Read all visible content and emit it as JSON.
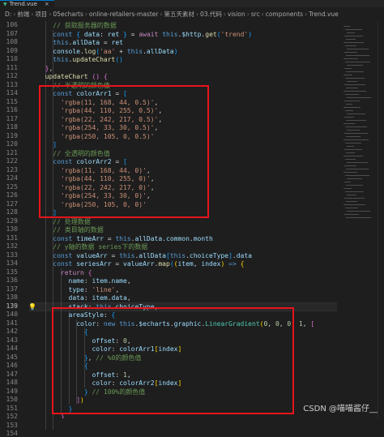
{
  "tab": {
    "label": "Trend.vue",
    "close": "×"
  },
  "breadcrumb": [
    "D:",
    "前端",
    "项目",
    "05echarts",
    "online-retailers-master",
    "第五天素材",
    "03.代码",
    "vision",
    "src",
    "components",
    "Trend.vue"
  ],
  "watermark": "CSDN @喵喵酱仔__",
  "lines": [
    {
      "n": "106",
      "h": "<span class=\"cm\">// 获取服务器的数据</span>",
      "i": 4
    },
    {
      "n": "107",
      "h": "<span class=\"kw\">const</span> <span class=\"br3\">{</span> <span class=\"var\">data</span>: <span class=\"var\">ret</span> <span class=\"br3\">}</span> = <span class=\"kw2\">await</span> <span class=\"kw\">this</span>.<span class=\"var\">$http</span>.<span class=\"fn\">get</span><span class=\"br3\">(</span><span class=\"str\">'trend'</span><span class=\"br3\">)</span>",
      "i": 4
    },
    {
      "n": "108",
      "h": "<span class=\"kw\">this</span>.<span class=\"var\">allData</span> = <span class=\"var\">ret</span>",
      "i": 4
    },
    {
      "n": "109",
      "h": "<span class=\"var\">console</span>.<span class=\"fn\">log</span><span class=\"br3\">(</span><span class=\"str\">'aa'</span> + <span class=\"kw\">this</span>.<span class=\"var\">allData</span><span class=\"br3\">)</span>",
      "i": 4
    },
    {
      "n": "110",
      "h": "<span class=\"kw\">this</span>.<span class=\"fn\">updateChart</span><span class=\"br3\">()</span>",
      "i": 4
    },
    {
      "n": "111",
      "h": "<span class=\"br2\">}</span>,",
      "i": 2
    },
    {
      "n": "112",
      "h": "<span class=\"fn\">updateChart</span> <span class=\"br2\">()</span> <span class=\"br2\">{</span>",
      "i": 2
    },
    {
      "n": "113",
      "h": "<span class=\"cm\">// 半透明的颜色值</span>",
      "i": 4
    },
    {
      "n": "114",
      "h": "<span class=\"kw\">const</span> <span class=\"var\">colorArr1</span> = <span class=\"br3\">[</span>",
      "i": 4
    },
    {
      "n": "115",
      "h": "<span class=\"str\">'rgba(11, 168, 44, 0.5)'</span>,",
      "i": 6
    },
    {
      "n": "116",
      "h": "<span class=\"str\">'rgba(44, 110, 255, 0.5)'</span>,",
      "i": 6
    },
    {
      "n": "117",
      "h": "<span class=\"str\">'rgba(22, 242, 217, 0.5)'</span>,",
      "i": 6
    },
    {
      "n": "118",
      "h": "<span class=\"str\">'rgba(254, 33, 30, 0.5)'</span>,",
      "i": 6
    },
    {
      "n": "119",
      "h": "<span class=\"str\">'rgba(250, 105, 0, 0.5)'</span>",
      "i": 6
    },
    {
      "n": "120",
      "h": "<span class=\"br3\">]</span>",
      "i": 4
    },
    {
      "n": "121",
      "h": "<span class=\"cm\">// 全透明的颜色值</span>",
      "i": 4
    },
    {
      "n": "122",
      "h": "<span class=\"kw\">const</span> <span class=\"var\">colorArr2</span> = <span class=\"br3\">[</span>",
      "i": 4
    },
    {
      "n": "123",
      "h": "<span class=\"str\">'rgba(11, 168, 44, 0)'</span>,",
      "i": 6
    },
    {
      "n": "124",
      "h": "<span class=\"str\">'rgba(44, 110, 255, 0)'</span>,",
      "i": 6
    },
    {
      "n": "125",
      "h": "<span class=\"str\">'rgba(22, 242, 217, 0)'</span>,",
      "i": 6
    },
    {
      "n": "126",
      "h": "<span class=\"str\">'rgba(254, 33, 30, 0)'</span>,",
      "i": 6
    },
    {
      "n": "127",
      "h": "<span class=\"str\">'rgba(250, 105, 0, 0)'</span>",
      "i": 6
    },
    {
      "n": "128",
      "h": "<span class=\"br3\">]</span>",
      "i": 4
    },
    {
      "n": "129",
      "h": "<span class=\"cm\">// 处理数据</span>",
      "i": 4
    },
    {
      "n": "130",
      "h": "<span class=\"cm\">// 类目轴的数据</span>",
      "i": 4
    },
    {
      "n": "131",
      "h": "<span class=\"kw\">const</span> <span class=\"var\">timeArr</span> = <span class=\"kw\">this</span>.<span class=\"var\">allData</span>.<span class=\"var\">common</span>.<span class=\"var\">month</span>",
      "i": 4
    },
    {
      "n": "132",
      "h": "<span class=\"cm\">// y轴的数据 series下的数据</span>",
      "i": 4
    },
    {
      "n": "133",
      "h": "<span class=\"kw\">const</span> <span class=\"var\">valueArr</span> = <span class=\"kw\">this</span>.<span class=\"var\">allData</span><span class=\"br3\">[</span><span class=\"kw\">this</span>.<span class=\"var\">choiceType</span><span class=\"br3\">]</span>.<span class=\"var\">data</span>",
      "i": 4
    },
    {
      "n": "134",
      "h": "<span class=\"kw\">const</span> <span class=\"var\">seriesArr</span> = <span class=\"var\">valueArr</span>.<span class=\"fn\">map</span><span class=\"br3\">(</span><span class=\"br\">(</span><span class=\"var\">item</span>, <span class=\"var\">index</span><span class=\"br\">)</span> <span class=\"kw\">=&gt;</span> <span class=\"br\">{</span>",
      "i": 4
    },
    {
      "n": "135",
      "h": "<span class=\"kw2\">return</span> <span class=\"br2\">{</span>",
      "i": 6
    },
    {
      "n": "136",
      "h": "<span class=\"prop\">name</span>: <span class=\"var\">item</span>.<span class=\"var\">name</span>,",
      "i": 8
    },
    {
      "n": "137",
      "h": "<span class=\"prop\">type</span>: <span class=\"str\">'line'</span>,",
      "i": 8
    },
    {
      "n": "138",
      "h": "<span class=\"prop\">data</span>: <span class=\"var\">item</span>.<span class=\"var\">data</span>,",
      "i": 8
    },
    {
      "n": "139",
      "h": "<span class=\"prop\">stack</span>: <span class=\"kw\">this</span>.<span class=\"var\">choiceType</span>,",
      "i": 8
    },
    {
      "n": "140",
      "h": "<span class=\"prop\">areaStyle</span>: <span class=\"br3\">{</span>",
      "i": 8
    },
    {
      "n": "141",
      "h": "<span class=\"prop\">color</span>: <span class=\"kw\">new</span> <span class=\"kw\">this</span>.<span class=\"var\">$echarts</span>.<span class=\"var\">graphic</span>.<span class=\"cls\">LinearGradient</span><span class=\"br\">(</span><span class=\"num\">0</span>, <span class=\"num\">0</span>, <span class=\"num\">0</span>, <span class=\"num\">1</span>, <span class=\"br2\">[</span>",
      "i": 10
    },
    {
      "n": "142",
      "h": "<span class=\"br3\">{</span>",
      "i": 12
    },
    {
      "n": "143",
      "h": "<span class=\"prop\">offset</span>: <span class=\"num\">0</span>,",
      "i": 14
    },
    {
      "n": "144",
      "h": "<span class=\"prop\">color</span>: <span class=\"var\">colorArr1</span><span class=\"br\">[</span><span class=\"var\">index</span><span class=\"br\">]</span>",
      "i": 14
    },
    {
      "n": "145",
      "h": "<span class=\"br3\">}</span>, <span class=\"cm\">// %0的颜色值</span>",
      "i": 12
    },
    {
      "n": "146",
      "h": "<span class=\"br3\">{</span>",
      "i": 12
    },
    {
      "n": "147",
      "h": "<span class=\"prop\">offset</span>: <span class=\"num\">1</span>,",
      "i": 14
    },
    {
      "n": "148",
      "h": "<span class=\"prop\">color</span>: <span class=\"var\">colorArr2</span><span class=\"br\">[</span><span class=\"var\">index</span><span class=\"br\">]</span>",
      "i": 14
    },
    {
      "n": "149",
      "h": "<span class=\"br3\">}</span> <span class=\"cm\">// 100%的颜色值</span>",
      "i": 12
    },
    {
      "n": "150",
      "h": "<span class=\"br2\">]</span><span class=\"br\">)</span>",
      "i": 10
    },
    {
      "n": "151",
      "h": "<span class=\"br3\">}</span>",
      "i": 8
    },
    {
      "n": "152",
      "h": "<span class=\"br2\">}</span>",
      "i": 6
    },
    {
      "n": "153",
      "h": "<span class=\"br\">}</span><span class=\"br3\">)</span>",
      "i": 4
    },
    {
      "n": "154",
      "h": "<span class=\"cm\">// 图例的数据</span>",
      "i": 4
    }
  ],
  "active_line": "139",
  "colors": {
    "accent": "#007acc",
    "highlight_box": "#e8141c"
  },
  "icons": {
    "file": "vue-file-icon",
    "lightbulb": "lightbulb-icon"
  }
}
